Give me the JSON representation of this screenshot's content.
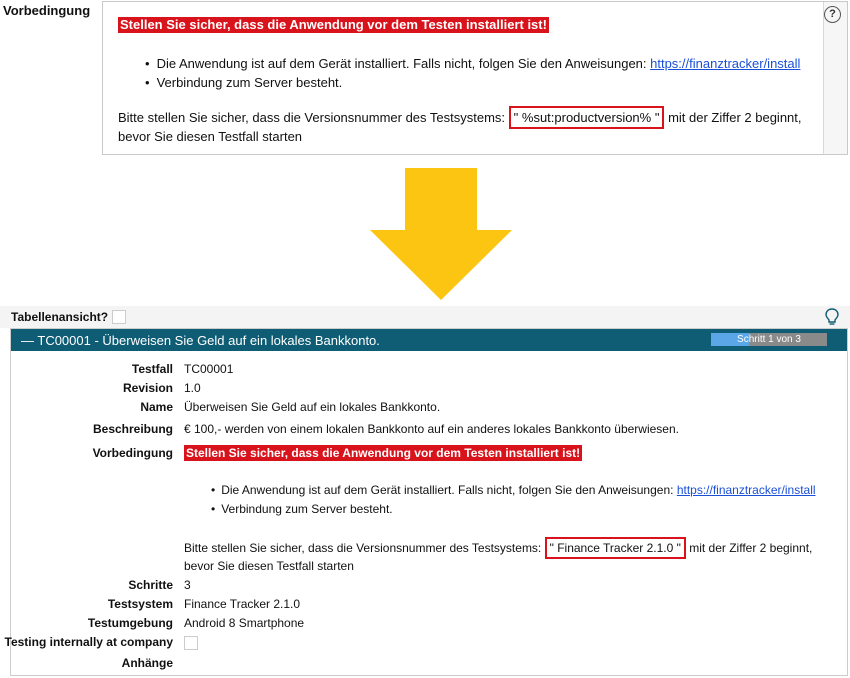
{
  "top": {
    "label": "Vorbedingung",
    "help_icon": "?",
    "warning": "Stellen Sie sicher, dass die Anwendung vor dem Testen installiert ist!",
    "bullet1": "Die Anwendung ist auf dem Gerät installiert. Falls nicht, folgen Sie den Anweisungen: ",
    "link": "https://finanztracker/install",
    "bullet2": "Verbindung zum Server besteht.",
    "para_before": "Bitte stellen Sie sicher, dass die Versionsnummer des Testsystems: ",
    "placeholder": "\" %sut:productversion% \"",
    "para_after": " mit der Ziffer 2 beginnt, bevor Sie diesen Testfall starten"
  },
  "arrow_color": "#fcc511",
  "bottom": {
    "table_view_label": "Tabellenansicht?",
    "header_title": "— TC00001 - Überweisen Sie Geld auf ein lokales Bankkonto.",
    "progress_label": "Schritt 1 von 3",
    "progress_fraction": 0.33,
    "fields": {
      "testfall_label": "Testfall",
      "testfall": "TC00001",
      "revision_label": "Revision",
      "revision": "1.0",
      "name_label": "Name",
      "name": "Überweisen Sie Geld auf ein lokales Bankkonto.",
      "beschreibung_label": "Beschreibung",
      "beschreibung": "€ 100,- werden von einem lokalen Bankkonto auf ein anderes lokales Bankkonto überwiesen.",
      "vorbedingung_label": "Vorbedingung",
      "warning": "Stellen Sie sicher, dass die Anwendung vor dem Testen installiert ist!",
      "bullet1": "Die Anwendung ist auf dem Gerät installiert. Falls nicht, folgen Sie den Anweisungen: ",
      "link": "https://finanztracker/install",
      "bullet2": "Verbindung zum Server besteht.",
      "para_before": "Bitte stellen Sie sicher, dass die Versionsnummer des Testsystems: ",
      "resolved": "\" Finance Tracker 2.1.0 \"",
      "para_after": " mit der Ziffer 2 beginnt, bevor Sie diesen Testfall starten",
      "schritte_label": "Schritte",
      "schritte": "3",
      "testsystem_label": "Testsystem",
      "testsystem": "Finance Tracker 2.1.0",
      "testumgebung_label": "Testumgebung",
      "testumgebung": "Android 8 Smartphone",
      "internal_label": "Testing internally at company",
      "anhaenge_label": "Anhänge"
    }
  }
}
